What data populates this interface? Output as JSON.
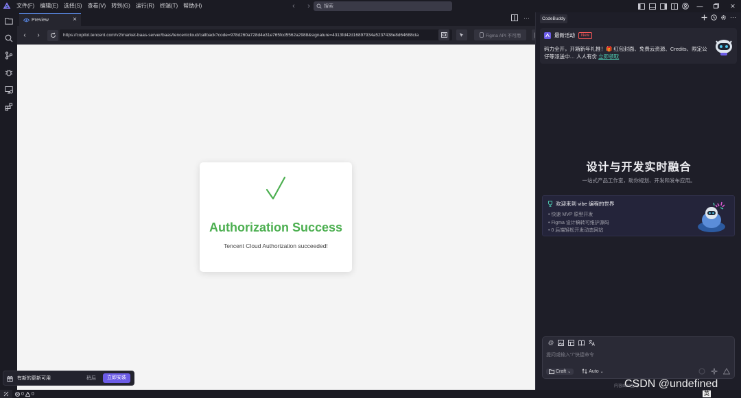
{
  "menu": [
    "文件(F)",
    "编辑(E)",
    "选择(S)",
    "查看(V)",
    "转到(G)",
    "运行(R)",
    "终端(T)",
    "帮助(H)"
  ],
  "title_search": {
    "placeholder": "搜索"
  },
  "editor": {
    "tab_label": "Preview",
    "url": "https://copilot.tencent.com/v2/market-baas-server/baas/tencentcloud/callback?code=978d260a728d4e31e765fcd5562a2988&signature=4313fd42d16897934a5237438e8d64688cta",
    "figma_label": "Figma API 不可用"
  },
  "auth": {
    "check": "✓",
    "title": "Authorization Success",
    "subtitle": "Tencent Cloud Authorization succeeded!"
  },
  "update_toast": {
    "message": "有新的更新可用",
    "later": "稍后",
    "install": "立即安装"
  },
  "status": {
    "errors": "0",
    "warnings": "0",
    "ime": "英"
  },
  "panel": {
    "tab": "CodeBuddy",
    "event": {
      "title": "最新活动",
      "badge": "New",
      "body": "码力全开，开箱新年礼推！🎁 红包封面、免费云资源、Credits、限定公仔等派送中… 人人有份 ",
      "link": "立即领取"
    },
    "hero_title": "设计与开发实时融合",
    "hero_sub": "一站式产品工作室，助你规划、开发和发布应用。",
    "vibe": {
      "title": "欢迎来到 vibe 编程的世界",
      "items": [
        "快速 MVP 原型开发",
        "Figma 设计稿转可维护源码",
        "0 后端轻松开发动态网站"
      ]
    },
    "chat": {
      "placeholder": "提问或输入\"/\"快捷命令",
      "mode": "Craft",
      "model": "Auto",
      "footer": "内容由AI生成"
    }
  },
  "watermark": "CSDN @undefined"
}
